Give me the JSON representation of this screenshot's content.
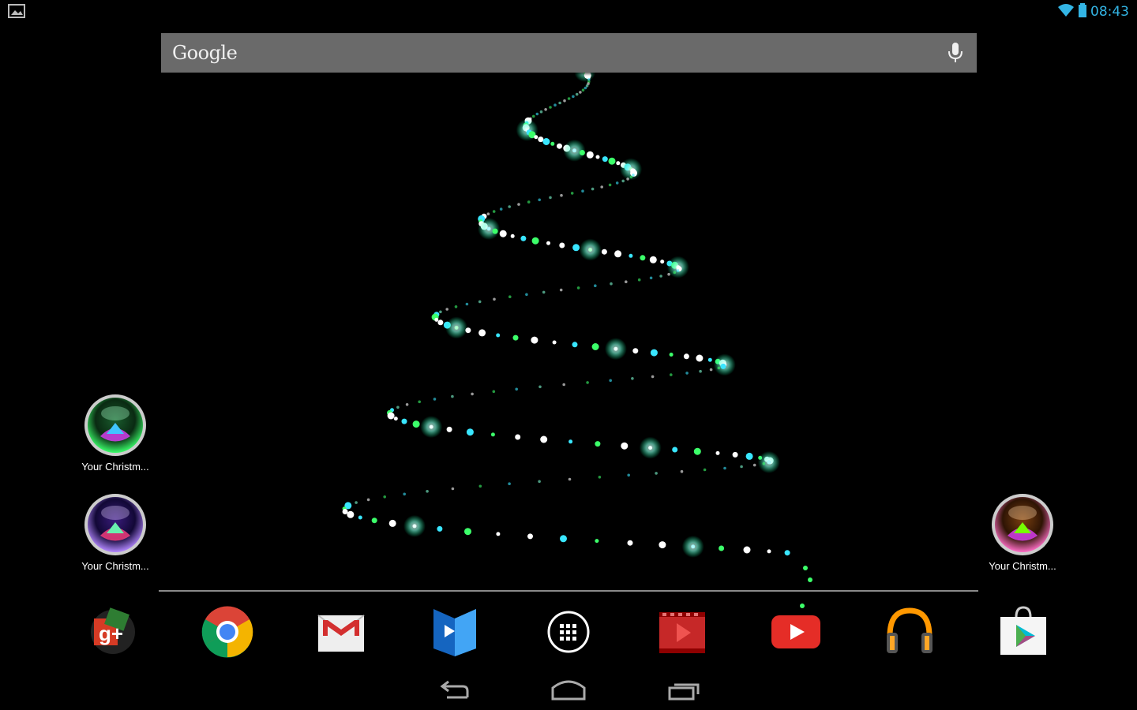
{
  "status_bar": {
    "time": "08:43",
    "left_icon": "image-notification-icon",
    "wifi_icon": "wifi-icon",
    "battery_icon": "battery-icon",
    "accent_color": "#33b5e5"
  },
  "search": {
    "logo": "Google",
    "mic_icon": "microphone-icon",
    "bar_color": "#6a6a6a"
  },
  "shortcuts": [
    {
      "label": "Your Christm...",
      "icon": "christmas-ornament-green-icon"
    },
    {
      "label": "Your Christm...",
      "icon": "christmas-ornament-purple-icon"
    },
    {
      "label": "Your Christm...",
      "icon": "christmas-ornament-orange-icon"
    }
  ],
  "dock": [
    {
      "icon": "google-plus-icon"
    },
    {
      "icon": "chrome-icon"
    },
    {
      "icon": "gmail-icon"
    },
    {
      "icon": "play-books-icon"
    },
    {
      "icon": "all-apps-icon"
    },
    {
      "icon": "play-movies-icon"
    },
    {
      "icon": "youtube-icon"
    },
    {
      "icon": "play-music-icon"
    },
    {
      "icon": "play-store-icon"
    }
  ],
  "nav": [
    {
      "icon": "back-icon"
    },
    {
      "icon": "home-icon"
    },
    {
      "icon": "recent-apps-icon"
    }
  ],
  "wallpaper": {
    "description_colors": [
      "#7fffd4",
      "#39e6ff",
      "#3cff6a",
      "#ffffff"
    ]
  }
}
